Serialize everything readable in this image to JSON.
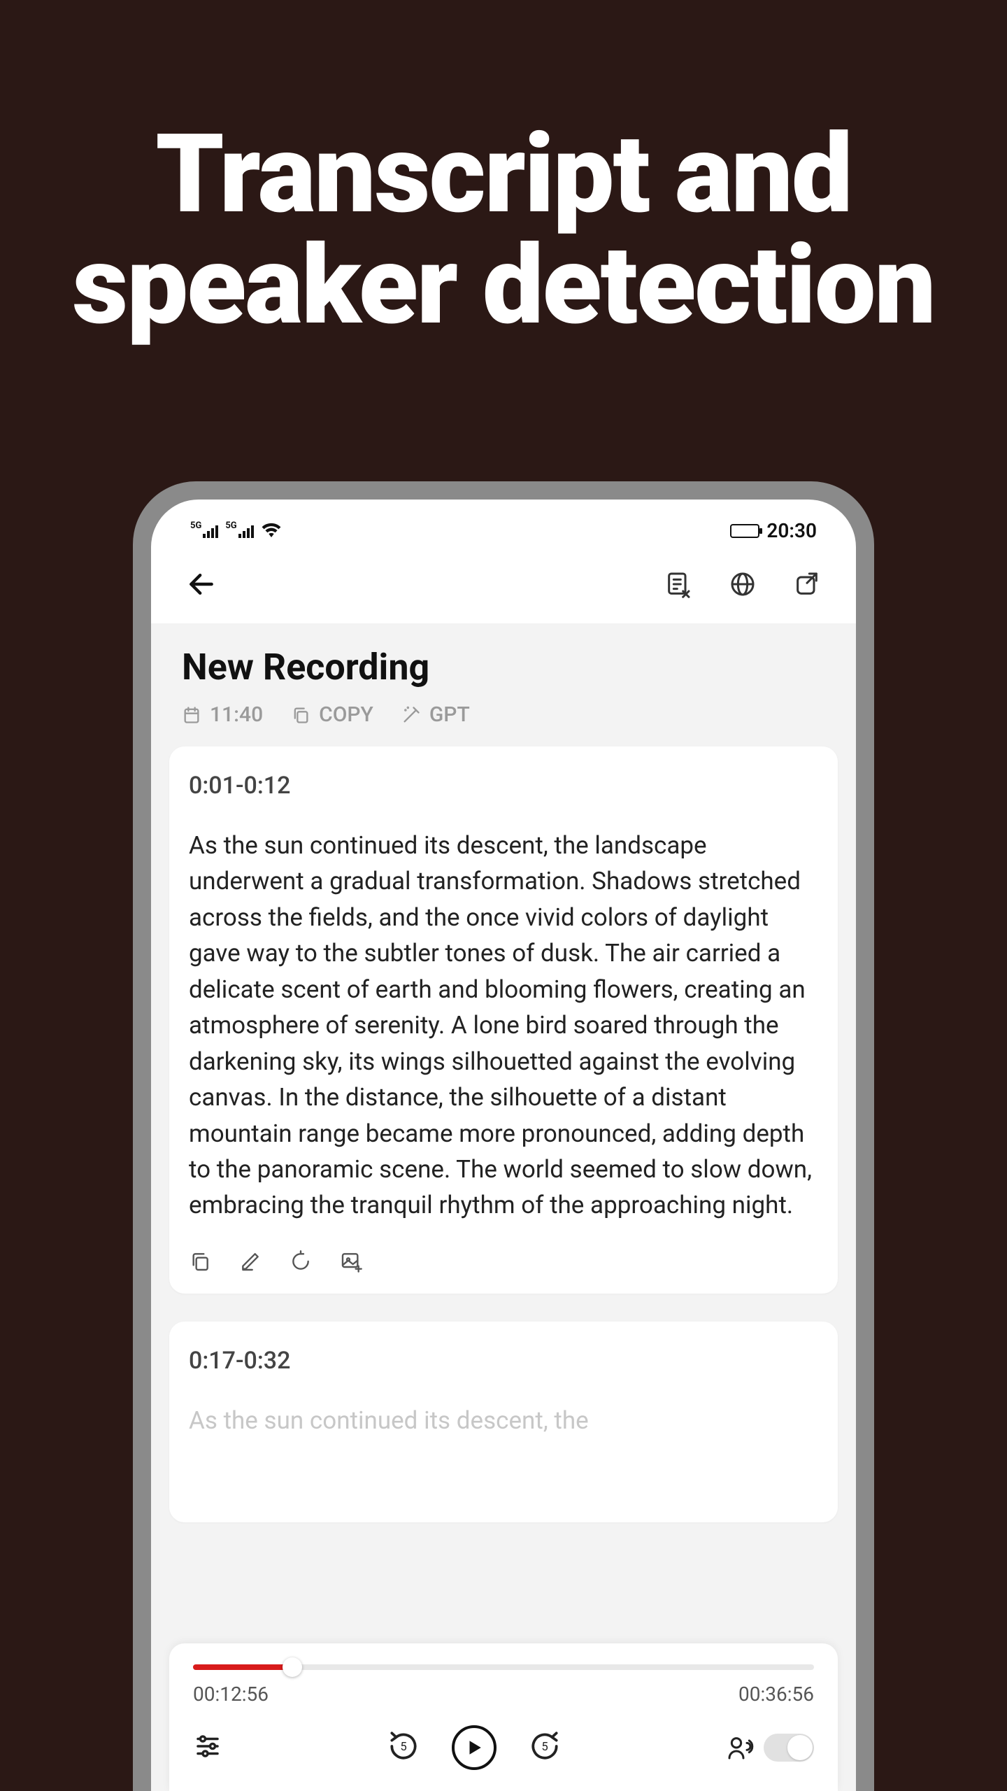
{
  "hero": {
    "line1": "Transcript and",
    "line2": "speaker detection"
  },
  "status": {
    "sig_label": "5G",
    "time": "20:30"
  },
  "header": {
    "title": "New Recording",
    "time": "11:40",
    "copy_label": "COPY",
    "gpt_label": "GPT"
  },
  "segments": [
    {
      "range": "0:01-0:12",
      "text": "As the sun continued its descent, the landscape underwent a gradual transformation. Shadows stretched across the fields, and the once vivid colors of daylight gave way to the subtler tones of dusk. The air carried a delicate scent of earth  and blooming flowers, creating an atmosphere of serenity. A lone bird soared through the darkening sky, its wings silhouetted against the evolving canvas. In the distance, the silhouette of a distant mountain range became more pronounced, adding depth to the panoramic scene. The world seemed to slow down, embracing the tranquil rhythm of the approaching night."
    },
    {
      "range": "0:17-0:32",
      "text": "As the sun continued its descent, the"
    }
  ],
  "player": {
    "elapsed": "00:12:56",
    "total": "00:36:56",
    "skip_back": "5",
    "skip_fwd": "5"
  }
}
